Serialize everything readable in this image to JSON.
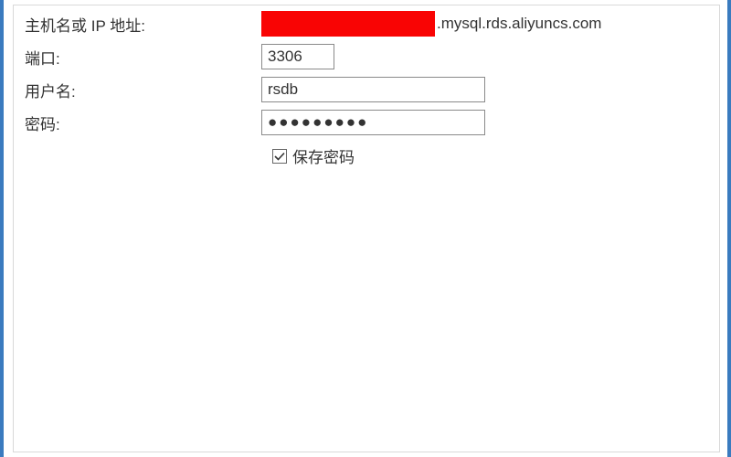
{
  "labels": {
    "host": "主机名或 IP 地址:",
    "port": "端口:",
    "user": "用户名:",
    "password": "密码:",
    "save_password": "保存密码"
  },
  "values": {
    "host_suffix": ".mysql.rds.aliyuncs.com",
    "port": "3306",
    "user": "rsdb",
    "password": "●●●●●●●●●",
    "save_password_checked": true
  }
}
